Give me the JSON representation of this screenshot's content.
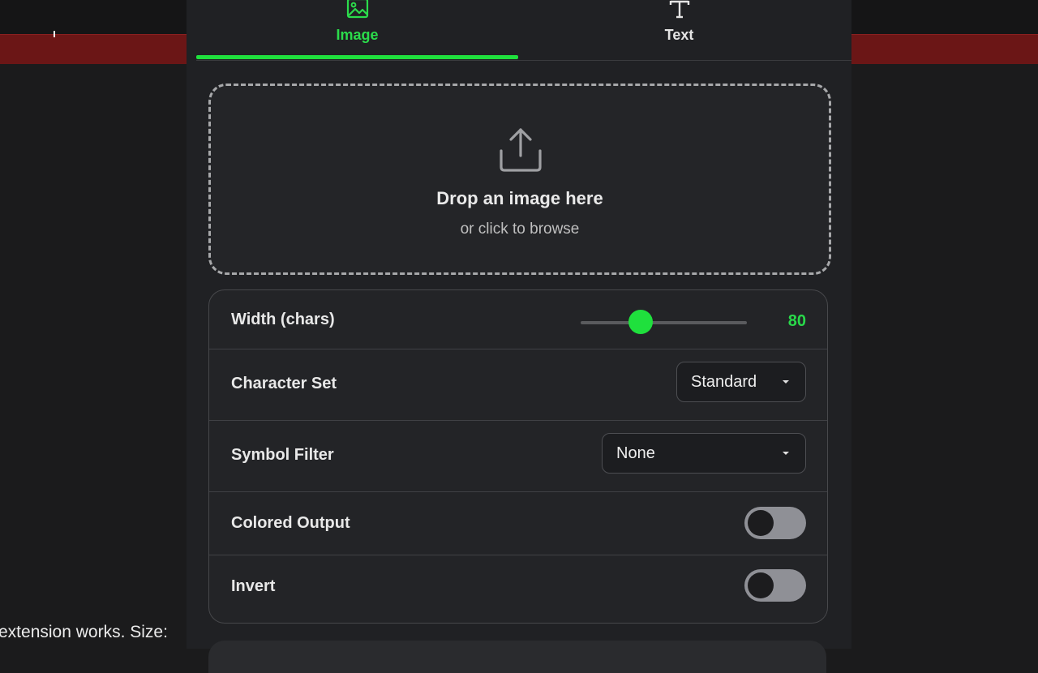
{
  "background": {
    "status_text": "extension works. Size:"
  },
  "tabs": [
    {
      "label": "Image",
      "icon": "image-icon",
      "active": true
    },
    {
      "label": "Text",
      "icon": "text-icon",
      "active": false
    }
  ],
  "dropzone": {
    "icon": "upload-icon",
    "title": "Drop an image here",
    "subtitle": "or click to browse"
  },
  "settings": {
    "width": {
      "label": "Width (chars)",
      "value": "80",
      "fraction": 0.36
    },
    "charset": {
      "label": "Character Set",
      "selected": "Standard"
    },
    "symbol_filter": {
      "label": "Symbol Filter",
      "selected": "None"
    },
    "colored_output": {
      "label": "Colored Output",
      "enabled": false
    },
    "invert": {
      "label": "Invert",
      "enabled": false
    }
  },
  "colors": {
    "accent": "#1fe03d",
    "panel": "#202124",
    "page": "#1b1b1c",
    "header_red": "#6b1616"
  }
}
